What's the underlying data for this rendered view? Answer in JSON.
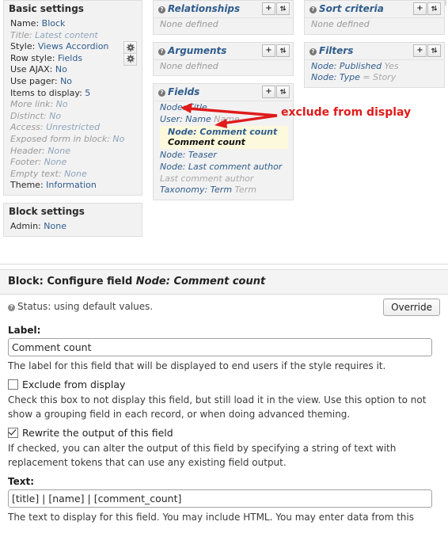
{
  "basic_settings": {
    "title": "Basic settings",
    "rows": [
      {
        "label": "Name:",
        "value": "Block",
        "dim": false,
        "gear": false
      },
      {
        "label": "Title:",
        "value": "Latest content",
        "dim": true,
        "gear": false
      },
      {
        "label": "Style:",
        "value": "Views Accordion",
        "dim": false,
        "gear": true
      },
      {
        "label": "Row style:",
        "value": "Fields",
        "dim": false,
        "gear": true
      },
      {
        "label": "Use AJAX:",
        "value": "No",
        "dim": false,
        "gear": false
      },
      {
        "label": "Use pager:",
        "value": "No",
        "dim": false,
        "gear": false
      },
      {
        "label": "Items to display:",
        "value": "5",
        "dim": false,
        "gear": false
      },
      {
        "label": "More link:",
        "value": "No",
        "dim": true,
        "gear": false
      },
      {
        "label": "Distinct:",
        "value": "No",
        "dim": true,
        "gear": false
      },
      {
        "label": "Access:",
        "value": "Unrestricted",
        "dim": true,
        "gear": false
      },
      {
        "label": "Exposed form in block:",
        "value": "No",
        "dim": true,
        "gear": false
      },
      {
        "label": "Header:",
        "value": "None",
        "dim": true,
        "gear": false
      },
      {
        "label": "Footer:",
        "value": "None",
        "dim": true,
        "gear": false
      },
      {
        "label": "Empty text:",
        "value": "None",
        "dim": true,
        "gear": false
      },
      {
        "label": "Theme:",
        "value": "Information",
        "dim": false,
        "gear": false
      }
    ]
  },
  "block_settings": {
    "title": "Block settings",
    "rows": [
      {
        "label": "Admin:",
        "value": "None",
        "dim": false,
        "gear": false
      }
    ]
  },
  "relationships": {
    "title": "Relationships",
    "empty_text": "None defined",
    "add_label": "+",
    "rearrange_label": "rearrange"
  },
  "arguments": {
    "title": "Arguments",
    "empty_text": "None defined",
    "add_label": "+",
    "rearrange_label": "rearrange"
  },
  "fields": {
    "title": "Fields",
    "add_label": "+",
    "rearrange_label": "rearrange",
    "items": [
      {
        "key": "Node: Title",
        "extra": "",
        "muted": false
      },
      {
        "key": "User: Name",
        "extra": "Name",
        "muted": false
      },
      {
        "key": "Node: Teaser",
        "extra": "",
        "muted": false
      },
      {
        "key": "Node: Last comment author",
        "extra": "",
        "muted": false
      },
      {
        "key": "Last comment author",
        "extra": "",
        "muted": true
      },
      {
        "key": "Taxonomy: Term",
        "extra": "Term",
        "muted": false
      }
    ],
    "highlighted": {
      "line1": "Node: Comment count",
      "line2": "Comment count"
    }
  },
  "sort_criteria": {
    "title": "Sort criteria",
    "empty_text": "None defined",
    "add_label": "+",
    "rearrange_label": "rearrange"
  },
  "filters": {
    "title": "Filters",
    "add_label": "+",
    "rearrange_label": "rearrange",
    "items": [
      {
        "key": "Node: Published",
        "value": "Yes"
      },
      {
        "key": "Node: Type",
        "value": "= Story"
      }
    ]
  },
  "annotation": {
    "text": "exclude from display",
    "color": "#e01b1b"
  },
  "config_form": {
    "heading_prefix": "Block: Configure field",
    "heading_field": "Node: Comment count",
    "status_text": "Status: using default values.",
    "override_button": "Override",
    "label_heading": "Label:",
    "label_value": "Comment count",
    "label_description": "The label for this field that will be displayed to end users if the style requires it.",
    "exclude_checkbox_label": "Exclude from display",
    "exclude_checked": false,
    "exclude_description": "Check this box to not display this field, but still load it in the view. Use this option to not show a grouping field in each record, or when doing advanced theming.",
    "rewrite_checkbox_label": "Rewrite the output of this field",
    "rewrite_checked": true,
    "rewrite_description": "If checked, you can alter the output of this field by specifying a string of text with replacement tokens that can use any existing field output.",
    "text_heading": "Text:",
    "text_value": "[title] | [name] | [comment_count]",
    "text_description": "The text to display for this field. You may include HTML. You may enter data from this"
  }
}
